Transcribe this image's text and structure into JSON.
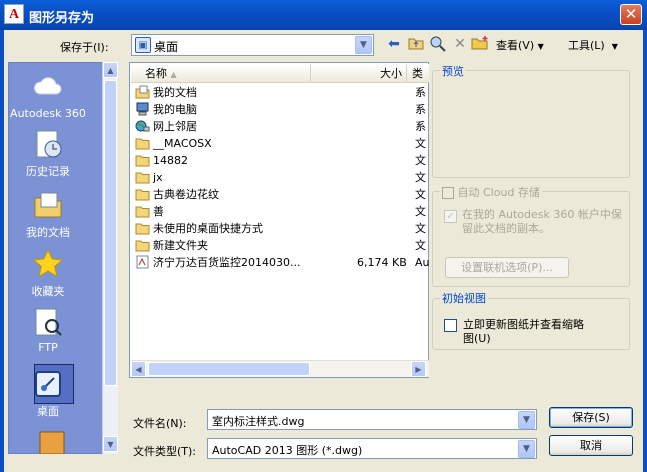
{
  "window": {
    "title": "图形另存为",
    "app_icon": "A"
  },
  "toolbar": {
    "save_in_label": "保存于(I):",
    "save_in_value": "桌面",
    "view_label": "查看(V)",
    "tools_label": "工具(L)"
  },
  "places": [
    {
      "label": "Autodesk 360",
      "icon": "cloud-icon"
    },
    {
      "label": "历史记录",
      "icon": "history-icon"
    },
    {
      "label": "我的文档",
      "icon": "documents-icon"
    },
    {
      "label": "收藏夹",
      "icon": "favorites-star-icon"
    },
    {
      "label": "FTP",
      "icon": "ftp-icon"
    },
    {
      "label": "桌面",
      "icon": "desktop-icon"
    }
  ],
  "filelist": {
    "columns": {
      "name": "名称",
      "size": "大小",
      "type": "类"
    },
    "rows": [
      {
        "name": "我的文档",
        "size": "",
        "type": "系",
        "icon": "documents"
      },
      {
        "name": "我的电脑",
        "size": "",
        "type": "系",
        "icon": "computer"
      },
      {
        "name": "网上邻居",
        "size": "",
        "type": "系",
        "icon": "network"
      },
      {
        "name": "__MACOSX",
        "size": "",
        "type": "文",
        "icon": "folder"
      },
      {
        "name": "14882",
        "size": "",
        "type": "文",
        "icon": "folder"
      },
      {
        "name": "jx",
        "size": "",
        "type": "文",
        "icon": "folder"
      },
      {
        "name": "古典卷边花纹",
        "size": "",
        "type": "文",
        "icon": "folder"
      },
      {
        "name": "善",
        "size": "",
        "type": "文",
        "icon": "folder"
      },
      {
        "name": "未使用的桌面快捷方式",
        "size": "",
        "type": "文",
        "icon": "folder"
      },
      {
        "name": "新建文件夹",
        "size": "",
        "type": "文",
        "icon": "folder"
      },
      {
        "name": "济宁万达百货监控2014030...",
        "size": "6,174 KB",
        "type": "Au",
        "icon": "dwg"
      }
    ]
  },
  "preview": {
    "title": "预览"
  },
  "cloud": {
    "title": "自动 Cloud 存储",
    "checkbox_text": "在我的 Autodesk 360 帐户中保留此文档的副本。",
    "online_button": "设置联机选项(P)..."
  },
  "thumbnail": {
    "title": "初始视图",
    "checkbox_text": "立即更新图纸并查看缩略图(U)"
  },
  "bottom": {
    "filename_label": "文件名(N):",
    "filename_value": "室内标注样式.dwg",
    "filetype_label": "文件类型(T):",
    "filetype_value": "AutoCAD 2013 图形 (*.dwg)",
    "save_button": "保存(S)",
    "cancel_button": "取消"
  },
  "colors": {
    "titlebar": "#0a4fc4",
    "places_bar": "#7b92d4",
    "dialog": "#ece9d8",
    "group_title": "#0046d5"
  }
}
